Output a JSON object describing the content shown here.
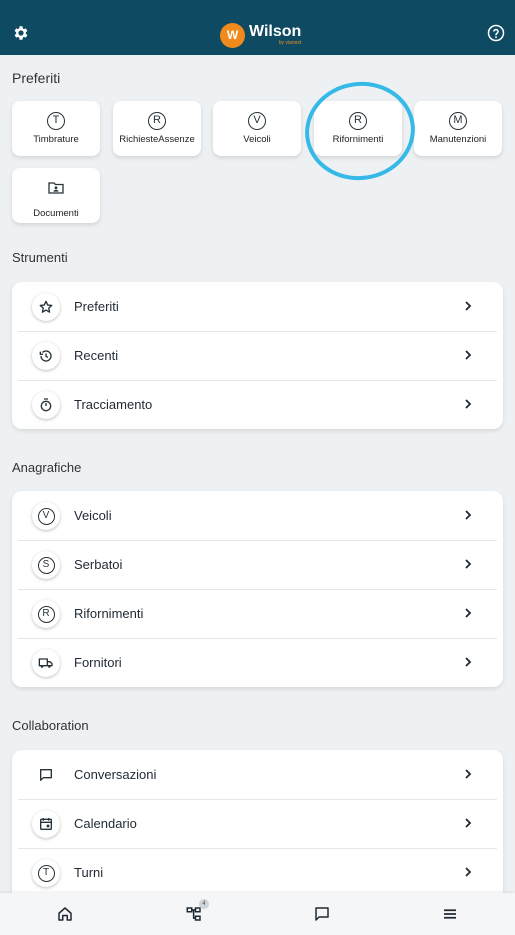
{
  "app": {
    "name": "Wilson",
    "byline": "by vianext",
    "logo_monogram": "W"
  },
  "favorites": {
    "title": "Preferiti",
    "items": [
      {
        "label": "Timbrature",
        "letter": "T",
        "icon": "circled-t-icon"
      },
      {
        "label": "RichiesteAssenze",
        "letter": "R",
        "icon": "circled-r-icon"
      },
      {
        "label": "Veicoli",
        "letter": "V",
        "icon": "circled-v-icon"
      },
      {
        "label": "Rifornimenti",
        "letter": "R",
        "icon": "circled-r-icon",
        "highlighted": true
      },
      {
        "label": "Manutenzioni",
        "letter": "M",
        "icon": "circled-m-icon"
      },
      {
        "label": "Documenti",
        "letter": "",
        "icon": "folder-account-icon"
      }
    ]
  },
  "tools": {
    "title": "Strumenti",
    "items": [
      {
        "label": "Preferiti",
        "icon": "star-icon"
      },
      {
        "label": "Recenti",
        "icon": "history-icon"
      },
      {
        "label": "Tracciamento",
        "icon": "stopwatch-icon"
      }
    ]
  },
  "registry": {
    "title": "Anagrafiche",
    "items": [
      {
        "label": "Veicoli",
        "letter": "V",
        "icon": "circled-v-icon"
      },
      {
        "label": "Serbatoi",
        "letter": "S",
        "icon": "circled-s-icon"
      },
      {
        "label": "Rifornimenti",
        "letter": "R",
        "icon": "circled-r-icon"
      },
      {
        "label": "Fornitori",
        "letter": "",
        "icon": "truck-icon"
      }
    ]
  },
  "collaboration": {
    "title": "Collaboration",
    "items": [
      {
        "label": "Conversazioni",
        "icon": "chat-icon"
      },
      {
        "label": "Calendario",
        "icon": "calendar-icon"
      },
      {
        "label": "Turni",
        "letter": "T",
        "icon": "circled-t-icon"
      }
    ]
  },
  "bottom_nav": {
    "items": [
      "home-icon",
      "hierarchy-icon",
      "chat-icon",
      "menu-icon"
    ],
    "badge": "4"
  },
  "colors": {
    "topbar": "#0e4b63",
    "brand_orange": "#f08a1c",
    "highlight": "#35b9e6",
    "background": "#eef1f3"
  }
}
